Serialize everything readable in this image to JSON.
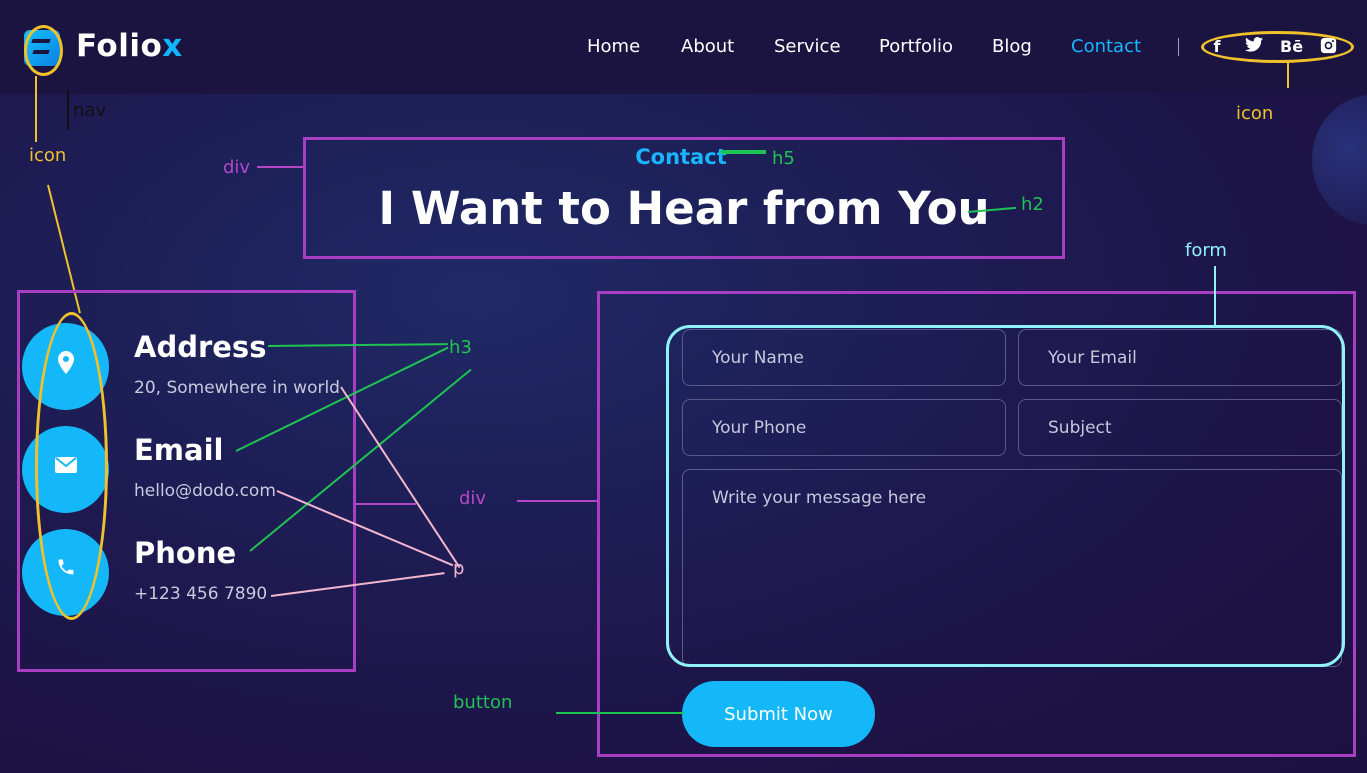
{
  "brand": {
    "name_main": "Folio",
    "name_accent": "x"
  },
  "nav": {
    "links": [
      "Home",
      "About",
      "Service",
      "Portfolio",
      "Blog",
      "Contact"
    ],
    "active": "Contact"
  },
  "social": [
    "f",
    "t",
    "Bē",
    "ig"
  ],
  "social_icons": [
    "facebook-icon",
    "twitter-icon",
    "behance-icon",
    "instagram-icon"
  ],
  "hero": {
    "eyebrow": "Contact",
    "title": "I Want to Hear from You"
  },
  "contact_info": [
    {
      "title": "Address",
      "text": "20, Somewhere in world",
      "icon": "map-pin-icon"
    },
    {
      "title": "Email",
      "text": "hello@dodo.com",
      "icon": "envelope-icon"
    },
    {
      "title": "Phone",
      "text": "+123 456 7890",
      "icon": "phone-icon"
    }
  ],
  "form": {
    "name_placeholder": "Your Name",
    "email_placeholder": "Your Email",
    "phone_placeholder": "Your Phone",
    "subject_placeholder": "Subject",
    "message_placeholder": "Write your message here",
    "submit_label": "Submit Now"
  },
  "annotations": {
    "nav": "nav",
    "icon_left": "icon",
    "icon_right": "icon",
    "div_hero": "div",
    "h5": "h5",
    "h2": "h2",
    "form": "form",
    "h3": "h3",
    "div_info": "div",
    "p": "p",
    "button": "button"
  },
  "colors": {
    "accent": "#14b8f9",
    "background": "#1d1346",
    "annotation_div": "#b447c8",
    "annotation_icon": "#f0c12a",
    "annotation_heading": "#1fc352",
    "annotation_p": "#f2b6cf",
    "annotation_form": "#8ef2f7"
  }
}
